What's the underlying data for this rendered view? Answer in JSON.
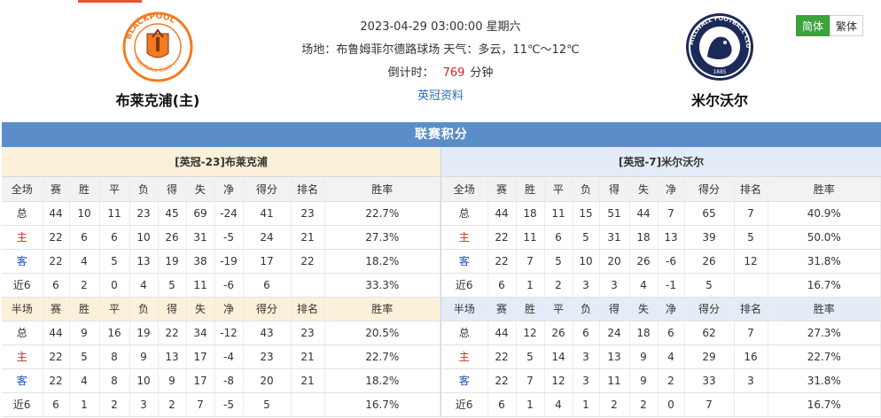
{
  "match": {
    "datetime": "2023-04-29 03:00:00 星期六",
    "venue_weather": "场地：布鲁姆菲尔德路球场 天气：多云，11℃～12℃",
    "countdown_label": "倒计时：",
    "countdown_value": "769",
    "countdown_unit": "分钟",
    "league_link": "英冠资料"
  },
  "home": {
    "name": "布莱克浦(主)",
    "crest_text": "BLACKPOOL FOOTBALL CLUB"
  },
  "away": {
    "name": "米尔沃尔",
    "crest_text": "MILLWALL FOOTBALL CLUB 1885"
  },
  "lang": {
    "simplified": "简体",
    "traditional": "繁体"
  },
  "standings": {
    "title": "联赛积分",
    "home_header": "[英冠-23]布莱克浦",
    "away_header": "[英冠-7]米尔沃尔",
    "columns_full": [
      "全场",
      "赛",
      "胜",
      "平",
      "负",
      "得",
      "失",
      "净",
      "得分",
      "排名",
      "胜率"
    ],
    "columns_half": [
      "半场",
      "赛",
      "胜",
      "平",
      "负",
      "得",
      "失",
      "净",
      "得分",
      "排名",
      "胜率"
    ],
    "home_full": [
      [
        "总",
        "44",
        "10",
        "11",
        "23",
        "45",
        "69",
        "-24",
        "41",
        "23",
        "22.7%"
      ],
      [
        "主",
        "22",
        "6",
        "6",
        "10",
        "26",
        "31",
        "-5",
        "24",
        "21",
        "27.3%"
      ],
      [
        "客",
        "22",
        "4",
        "5",
        "13",
        "19",
        "38",
        "-19",
        "17",
        "22",
        "18.2%"
      ],
      [
        "近6",
        "6",
        "2",
        "0",
        "4",
        "5",
        "11",
        "-6",
        "6",
        "",
        "33.3%"
      ]
    ],
    "home_half": [
      [
        "总",
        "44",
        "9",
        "16",
        "19",
        "22",
        "34",
        "-12",
        "43",
        "23",
        "20.5%"
      ],
      [
        "主",
        "22",
        "5",
        "8",
        "9",
        "13",
        "17",
        "-4",
        "23",
        "21",
        "22.7%"
      ],
      [
        "客",
        "22",
        "4",
        "8",
        "10",
        "9",
        "17",
        "-8",
        "20",
        "21",
        "18.2%"
      ],
      [
        "近6",
        "6",
        "1",
        "2",
        "3",
        "2",
        "7",
        "-5",
        "5",
        "",
        "16.7%"
      ]
    ],
    "away_full": [
      [
        "总",
        "44",
        "18",
        "11",
        "15",
        "51",
        "44",
        "7",
        "65",
        "7",
        "40.9%"
      ],
      [
        "主",
        "22",
        "11",
        "6",
        "5",
        "31",
        "18",
        "13",
        "39",
        "5",
        "50.0%"
      ],
      [
        "客",
        "22",
        "7",
        "5",
        "10",
        "20",
        "26",
        "-6",
        "26",
        "12",
        "31.8%"
      ],
      [
        "近6",
        "6",
        "1",
        "2",
        "3",
        "3",
        "4",
        "-1",
        "5",
        "",
        "16.7%"
      ]
    ],
    "away_half": [
      [
        "总",
        "44",
        "12",
        "26",
        "6",
        "24",
        "18",
        "6",
        "62",
        "7",
        "27.3%"
      ],
      [
        "主",
        "22",
        "5",
        "14",
        "3",
        "13",
        "9",
        "4",
        "29",
        "16",
        "22.7%"
      ],
      [
        "客",
        "22",
        "7",
        "12",
        "3",
        "11",
        "9",
        "2",
        "33",
        "3",
        "31.8%"
      ],
      [
        "近6",
        "6",
        "1",
        "4",
        "1",
        "2",
        "2",
        "0",
        "7",
        "",
        "16.7%"
      ]
    ]
  },
  "colors": {
    "banner": "#5b8ec9",
    "home_red": "#e02020",
    "away_blue": "#1f4fbf",
    "lang_active": "#3ba33b"
  },
  "icons": {
    "home_crest": "blackpool-crest-icon",
    "away_crest": "millwall-crest-icon"
  }
}
